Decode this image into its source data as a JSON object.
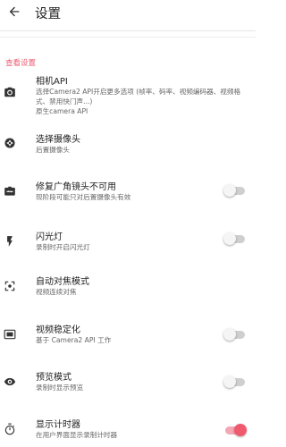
{
  "header": {
    "title": "设置",
    "back_icon": "arrow-back-icon"
  },
  "section": {
    "label": "查看设置"
  },
  "accent_color": "#ef5a6f",
  "items": [
    {
      "title": "相机API",
      "subtitle": "选择Camera2 API开启更多选项 (帧率、码率、视频编码器、视频格式、禁用快门声...)",
      "value": "原生camera API",
      "icon": "camera-icon"
    },
    {
      "title": "选择摄像头",
      "subtitle": "后置摄像头",
      "icon": "shutter-icon"
    },
    {
      "title": "修复广角镜头不可用",
      "subtitle": "现阶段可能只对后置摄像头有效",
      "icon": "switch-camera-icon",
      "enabled": false
    },
    {
      "title": "闪光灯",
      "subtitle": "录制时开启闪光灯",
      "icon": "flash-icon",
      "enabled": false
    },
    {
      "title": "自动对焦模式",
      "subtitle": "视频连续对焦",
      "icon": "center-focus-icon"
    },
    {
      "title": "视频稳定化",
      "subtitle": "基于 Camera2 API 工作",
      "icon": "stabilization-icon",
      "enabled": false
    },
    {
      "title": "预览模式",
      "subtitle": "录制时显示预览",
      "icon": "eye-icon",
      "enabled": false
    },
    {
      "title": "显示计时器",
      "subtitle": "在用户界面显示录制计时器",
      "icon": "timer-icon",
      "enabled": true
    }
  ]
}
